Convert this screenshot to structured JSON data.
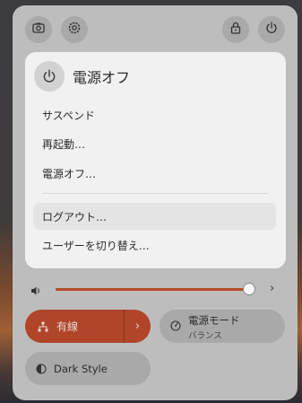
{
  "top_buttons": [
    {
      "icon": "screenshot-icon"
    },
    {
      "icon": "settings-icon"
    },
    {
      "icon": "lock-icon"
    },
    {
      "icon": "power-icon"
    }
  ],
  "power_menu": {
    "title": "電源オフ",
    "items": [
      {
        "label": "サスペンド"
      },
      {
        "label": "再起動…"
      },
      {
        "label": "電源オフ…"
      },
      {
        "label": "ログアウト…"
      },
      {
        "label": "ユーザーを切り替え…"
      }
    ]
  },
  "volume": {
    "icon": "speaker-icon",
    "level": 0.97,
    "expand_glyph": "›"
  },
  "toggles": {
    "wired": {
      "label": "有線",
      "active": true,
      "arrow": "›",
      "color": "#b0452a"
    },
    "power_mode": {
      "title": "電源モード",
      "subtitle": "バランス"
    },
    "dark_style": {
      "label": "Dark Style"
    }
  }
}
